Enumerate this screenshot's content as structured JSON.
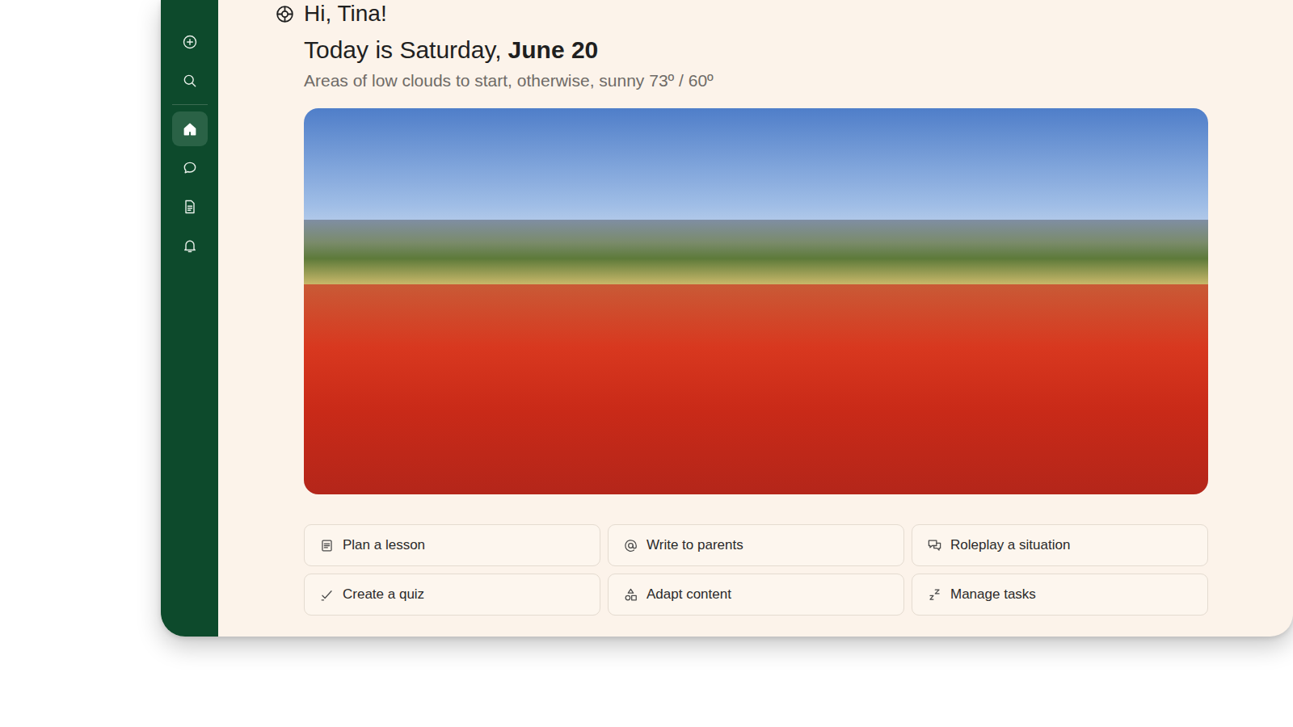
{
  "sidebar": {
    "items": [
      {
        "kind": "add",
        "selected": false
      },
      {
        "kind": "search",
        "selected": false
      },
      {
        "kind": "home",
        "selected": true
      },
      {
        "kind": "chat",
        "selected": false
      },
      {
        "kind": "document",
        "selected": false
      },
      {
        "kind": "bell",
        "selected": false
      }
    ]
  },
  "header": {
    "greeting": "Hi, Tina!",
    "date_prefix": "Today is Saturday,",
    "date": "June 20",
    "weather": "Areas of low clouds to start, otherwise, sunny 73º / 60º"
  },
  "actions": [
    {
      "label": "Plan a lesson",
      "kind": "lesson"
    },
    {
      "label": "Write to parents",
      "kind": "email"
    },
    {
      "label": "Roleplay a situation",
      "kind": "roleplay"
    },
    {
      "label": "Create a quiz",
      "kind": "quiz"
    },
    {
      "label": "Adapt content",
      "kind": "adapt"
    },
    {
      "label": "Manage tasks",
      "kind": "tasks"
    }
  ]
}
